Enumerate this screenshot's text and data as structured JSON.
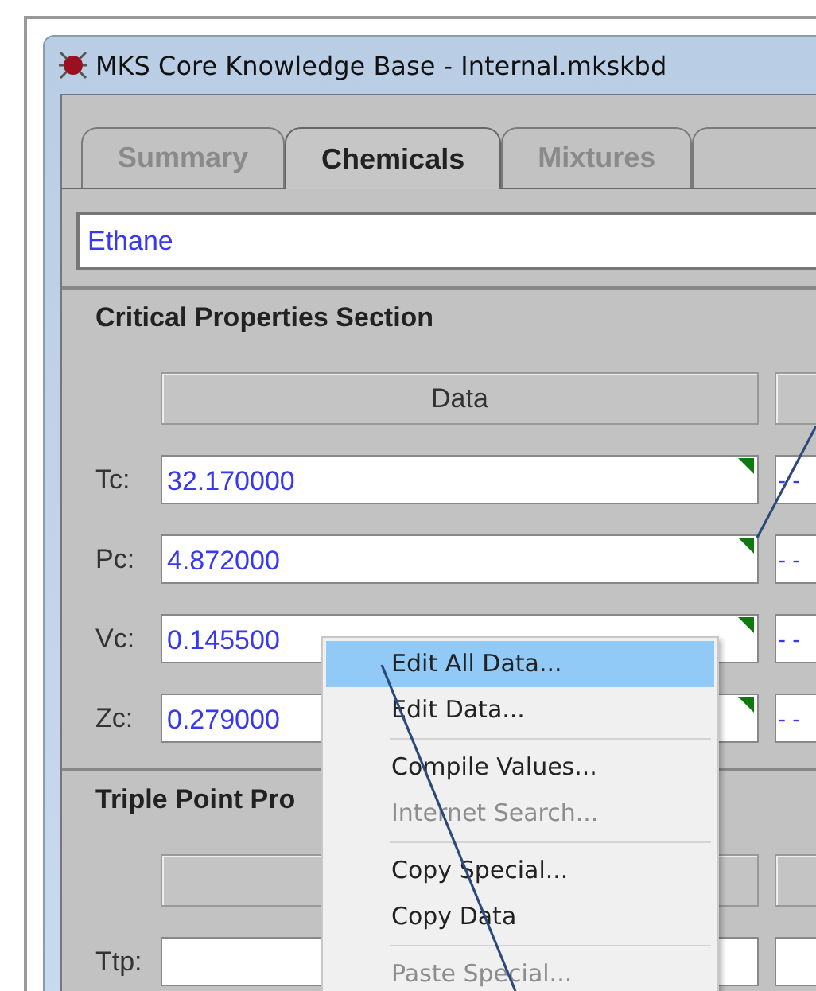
{
  "window": {
    "title": "MKS Core Knowledge Base - Internal.mkskbd"
  },
  "tabs": [
    {
      "label": "Summary",
      "selected": false,
      "disabled": true
    },
    {
      "label": "Chemicals",
      "selected": true,
      "disabled": false
    },
    {
      "label": "Mixtures",
      "selected": false,
      "disabled": true
    },
    {
      "selected": false,
      "disabled": true
    }
  ],
  "chemical_field": {
    "value": "Ethane"
  },
  "sections": [
    {
      "title": "Critical Properties Section",
      "columns": [
        "Data",
        ""
      ],
      "rows": [
        {
          "label": "Tc:",
          "value": "32.170000",
          "flagged": true,
          "column_2": "- -"
        },
        {
          "label": "Pc:",
          "value": "4.872000",
          "flagged": true,
          "column_2": "- -"
        },
        {
          "label": "Vc:",
          "value": "0.145500",
          "flagged": true,
          "column_2": "- -"
        },
        {
          "label": "Zc:",
          "value": "0.279000",
          "flagged": true,
          "column_2": "- -"
        }
      ]
    },
    {
      "title": "Triple Point Pro",
      "columns": [
        "",
        ""
      ],
      "rows": [
        {
          "label": "Ttp:",
          "value": "",
          "flagged": false,
          "column_2": ""
        }
      ]
    }
  ],
  "context_menu": {
    "items": [
      {
        "kind": "item",
        "label": "Edit All Data...",
        "selected": true,
        "disabled": false
      },
      {
        "kind": "item",
        "label": "Edit Data...",
        "selected": false,
        "disabled": false
      },
      {
        "kind": "separator"
      },
      {
        "kind": "item",
        "label": "Compile Values...",
        "selected": false,
        "disabled": false
      },
      {
        "kind": "item",
        "label": "Internet Search...",
        "selected": false,
        "disabled": true
      },
      {
        "kind": "separator"
      },
      {
        "kind": "item",
        "label": "Copy Special...",
        "selected": false,
        "disabled": false
      },
      {
        "kind": "item",
        "label": "Copy Data",
        "selected": false,
        "disabled": false
      },
      {
        "kind": "separator"
      },
      {
        "kind": "item",
        "label": "Paste Special...",
        "selected": false,
        "disabled": true
      }
    ]
  }
}
